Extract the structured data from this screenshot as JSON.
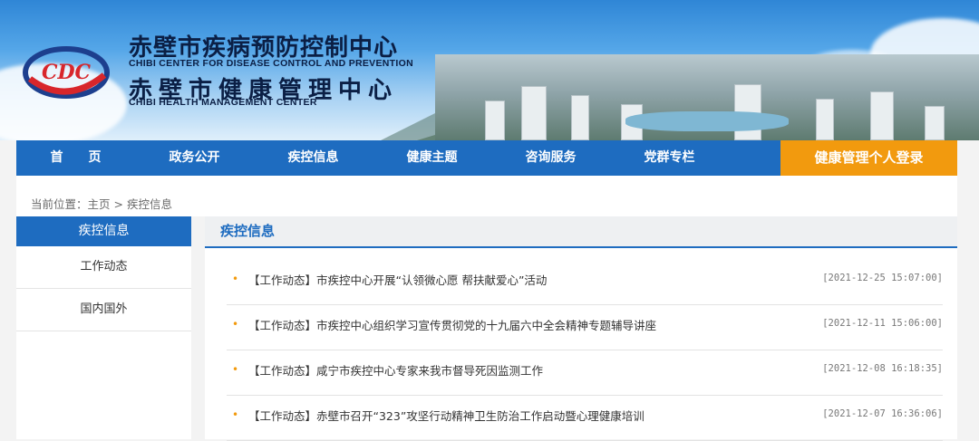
{
  "header": {
    "title_cn_1": "赤壁市疾病预防控制中心",
    "title_en_1": "CHIBI CENTER FOR DISEASE CONTROL AND PREVENTION",
    "title_cn_2": "赤壁市健康管理中心",
    "title_en_2": "CHIBI HEALTH MANAGEMENT CENTER",
    "logo_text": "CDC"
  },
  "nav": {
    "items": [
      {
        "label": "首　　页"
      },
      {
        "label": "政务公开"
      },
      {
        "label": "疾控信息"
      },
      {
        "label": "健康主题"
      },
      {
        "label": "咨询服务"
      },
      {
        "label": "党群专栏"
      }
    ],
    "login_label": "健康管理个人登录"
  },
  "breadcrumb": {
    "prefix": "当前位置：",
    "home": "主页",
    "separator": ">",
    "current": "疾控信息"
  },
  "sidebar": {
    "heading": "疾控信息",
    "items": [
      {
        "label": "工作动态"
      },
      {
        "label": "国内国外"
      }
    ]
  },
  "main": {
    "heading": "疾控信息",
    "articles": [
      {
        "title": "【工作动态】市疾控中心开展“认领微心愿 帮扶献爱心”活动",
        "date": "[2021-12-25 15:07:00]"
      },
      {
        "title": "【工作动态】市疾控中心组织学习宣传贯彻党的十九届六中全会精神专题辅导讲座",
        "date": "[2021-12-11 15:06:00]"
      },
      {
        "title": "【工作动态】咸宁市疾控中心专家来我市督导死因监测工作",
        "date": "[2021-12-08 16:18:35]"
      },
      {
        "title": "【工作动态】赤壁市召开“323”攻坚行动精神卫生防治工作启动暨心理健康培训",
        "date": "[2021-12-07 16:36:06]"
      }
    ]
  },
  "colors": {
    "nav_blue": "#1e6cc0",
    "login_orange": "#f29a0e",
    "title_navy": "#0b1f45"
  }
}
